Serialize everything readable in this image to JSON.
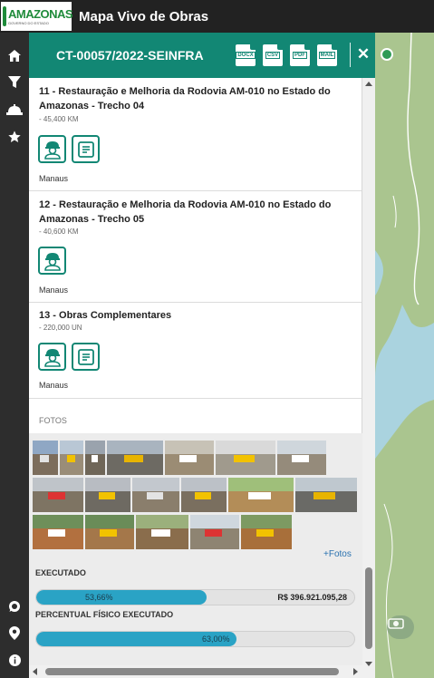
{
  "app": {
    "logo_text": "AMAZONAS",
    "logo_subtitle": "GOVERNO DO ESTADO",
    "title": "Mapa Vivo de Obras"
  },
  "panel": {
    "contract_code": "CT-00057/2022-SEINFRA",
    "exports": [
      "DOCX",
      "CSV",
      "PDF",
      "MAIL"
    ],
    "close_icon": "close-icon"
  },
  "items": [
    {
      "title": "11 - Restauração e Melhoria da Rodovia AM-010 no Estado do Amazonas - Trecho 04",
      "quantity": "- 45,400 KM",
      "icons": [
        "worker-icon",
        "report-icon"
      ],
      "location": "Manaus"
    },
    {
      "title": "12 - Restauração e Melhoria da Rodovia AM-010 no Estado do Amazonas - Trecho 05",
      "quantity": "- 40,600 KM",
      "icons": [
        "worker-icon"
      ],
      "location": "Manaus"
    },
    {
      "title": "13 - Obras Complementares",
      "quantity": "- 220,000 UN",
      "icons": [
        "worker-icon",
        "report-icon"
      ],
      "location": "Manaus"
    }
  ],
  "photos": {
    "section_label": "FOTOS",
    "more_link": "+Fotos",
    "thumbnail_count": 21
  },
  "execution": {
    "executed_label": "EXECUTADO",
    "executed_percent_text": "53,66%",
    "executed_fraction": 0.5366,
    "executed_amount": "R$ 396.921.095,28",
    "physical_label": "PERCENTUAL FÍSICO EXECUTADO",
    "physical_percent_text": "63,00%",
    "physical_fraction": 0.63
  },
  "colors": {
    "primary": "#128774",
    "progress": "#2aa3c5",
    "topbar": "#222222",
    "link": "#2b72b0"
  }
}
